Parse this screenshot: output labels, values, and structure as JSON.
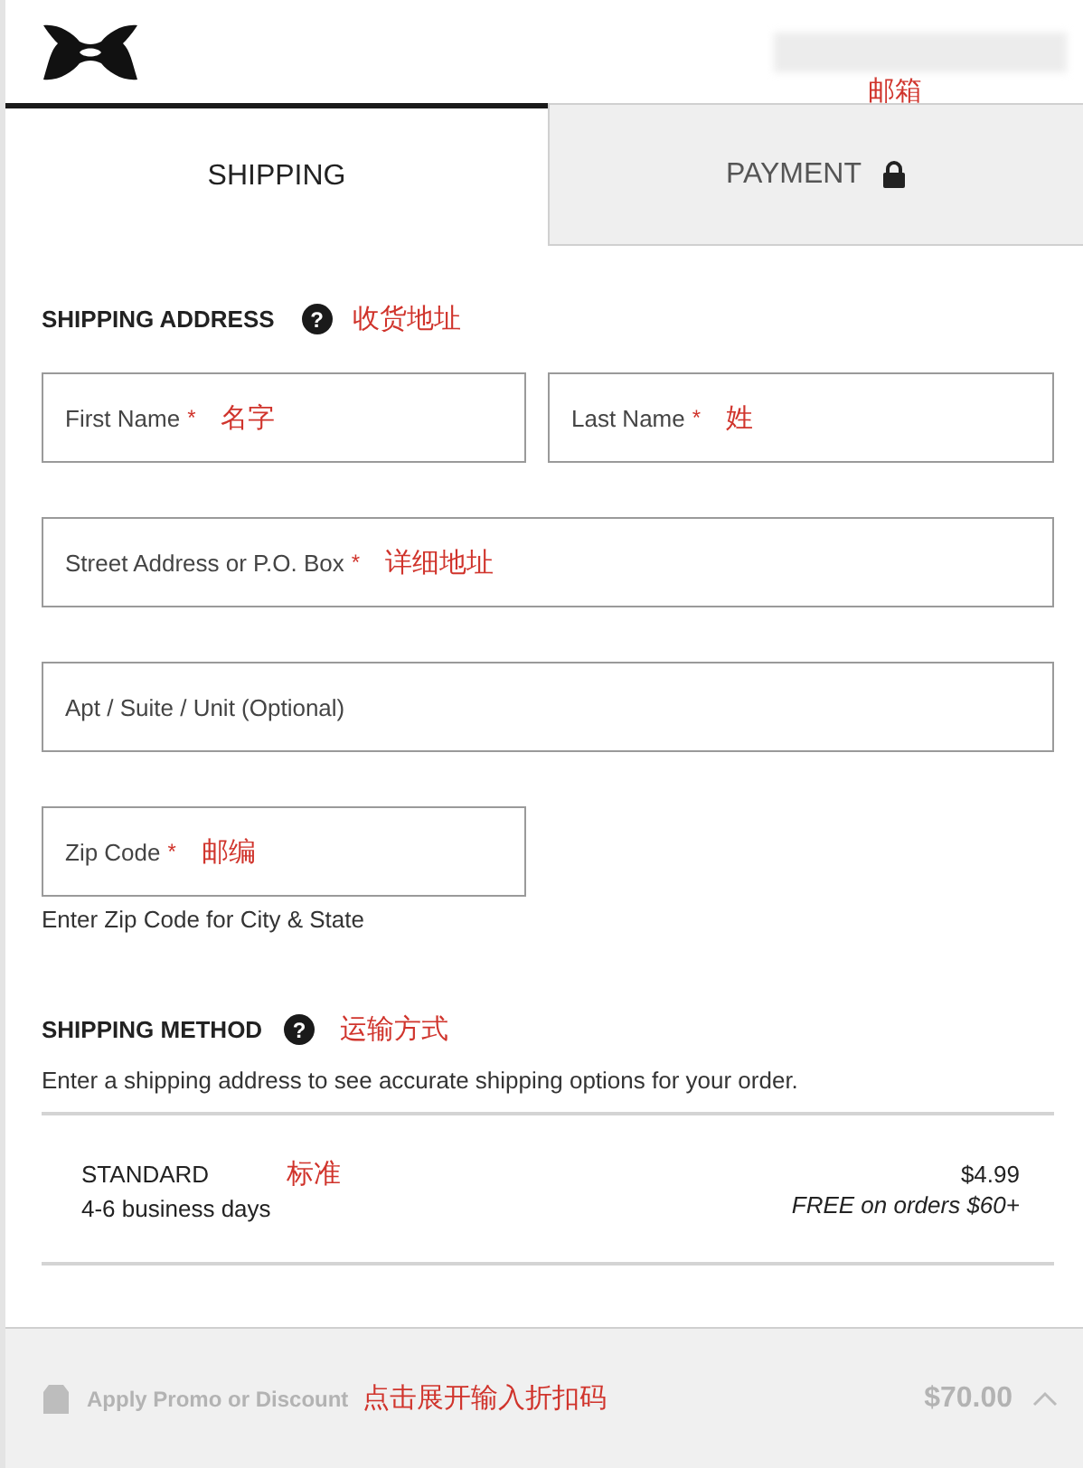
{
  "header": {
    "account_note": "邮箱"
  },
  "tabs": [
    {
      "label": "SHIPPING",
      "selected": true,
      "locked": false
    },
    {
      "label": "PAYMENT",
      "selected": false,
      "locked": true
    }
  ],
  "shipping_address": {
    "title": "SHIPPING ADDRESS",
    "help": "?",
    "note": "收货地址",
    "fields": [
      {
        "label": "First Name",
        "required_mark": "*",
        "note": "名字",
        "wide": false
      },
      {
        "label": "Last Name",
        "required_mark": "*",
        "note": "姓",
        "wide": false
      },
      {
        "label": "Street Address or P.O. Box",
        "required_mark": "*",
        "note": "详细地址",
        "wide": true
      },
      {
        "label": "Apt / Suite / Unit (Optional)",
        "wide": true
      },
      {
        "label": "Zip Code",
        "required_mark": "*",
        "note": "邮编",
        "wide": false
      }
    ],
    "zip_hint": "Enter Zip Code for City & State"
  },
  "shipping_method": {
    "title": "SHIPPING METHOD",
    "help": "?",
    "note": "运输方式",
    "description": "Enter a shipping address to see accurate shipping options for your order.",
    "options": [
      {
        "name": "STANDARD",
        "note": "标准",
        "duration": "4-6 business days",
        "price": "$4.99",
        "offer": "FREE on orders $60+"
      }
    ]
  },
  "promo_bar": {
    "label": "Apply Promo or Discount",
    "note": "点击展开输入折扣码",
    "total": "$70.00"
  }
}
